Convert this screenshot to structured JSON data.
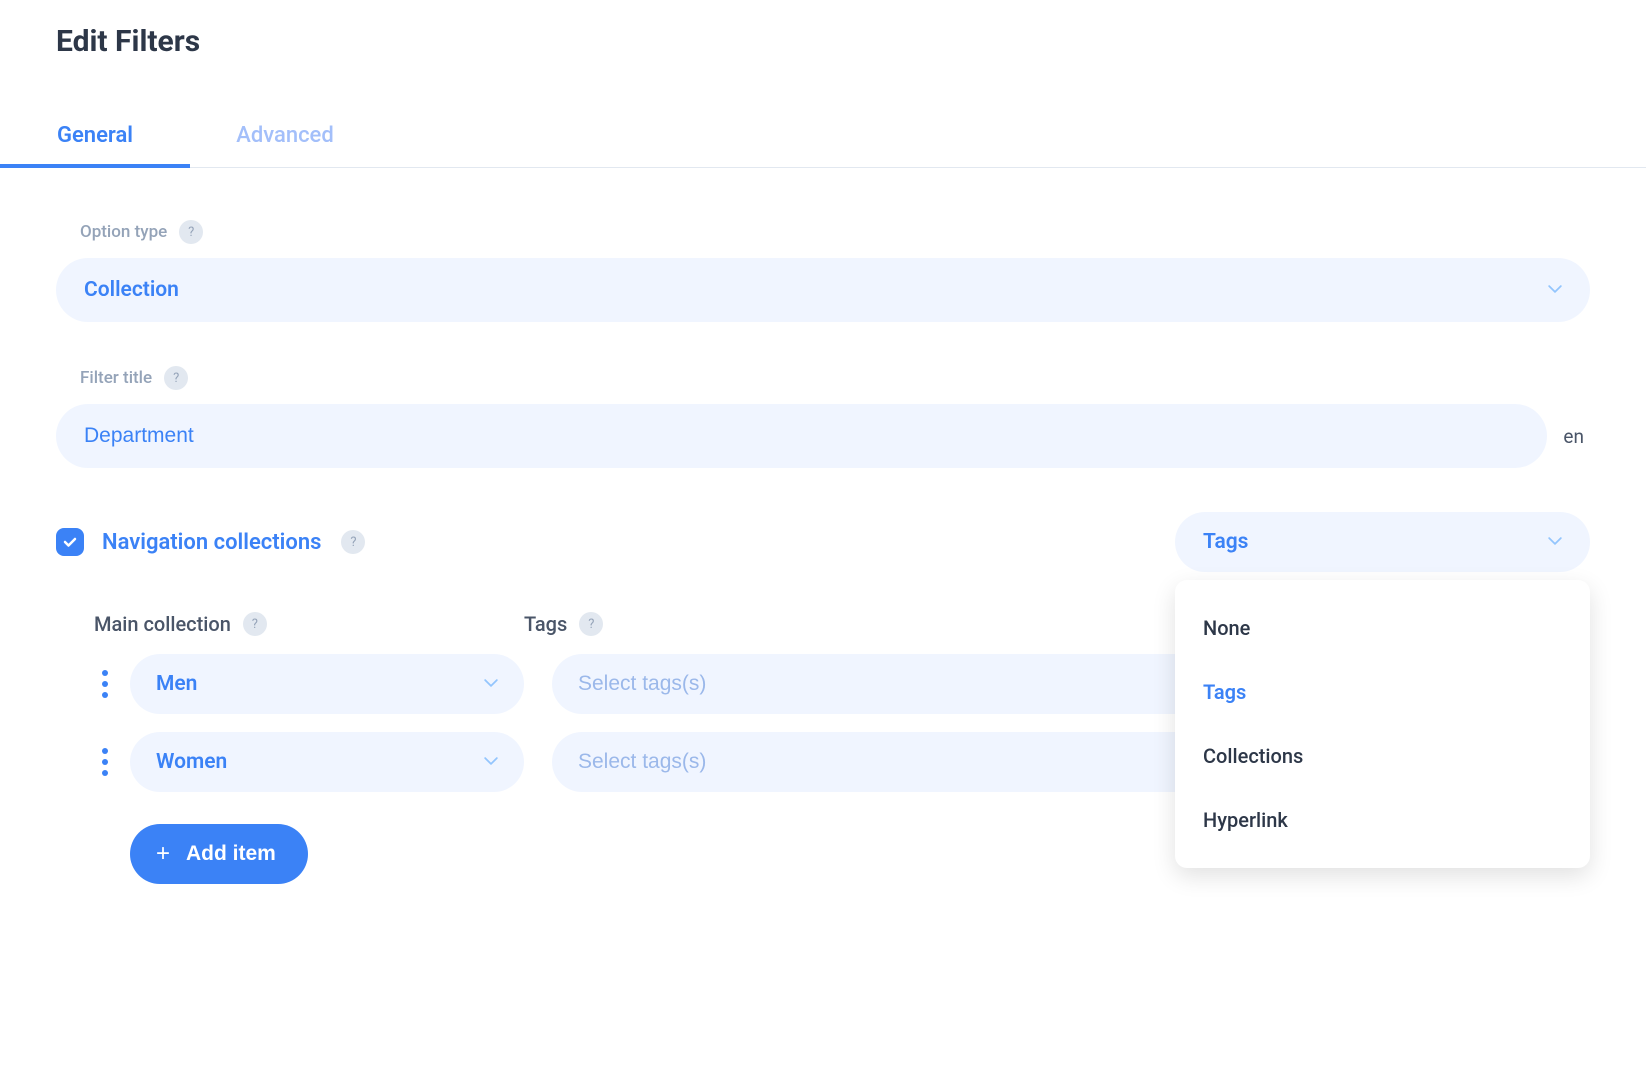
{
  "page": {
    "title": "Edit Filters"
  },
  "tabs": [
    {
      "label": "General",
      "active": true
    },
    {
      "label": "Advanced",
      "active": false
    }
  ],
  "fields": {
    "optionType": {
      "label": "Option type",
      "value": "Collection"
    },
    "filterTitle": {
      "label": "Filter title",
      "value": "Department",
      "langCode": "en"
    },
    "navCollections": {
      "label": "Navigation collections",
      "checked": true
    },
    "subCollectionType": {
      "value": "Tags",
      "options": [
        {
          "label": "None",
          "selected": false
        },
        {
          "label": "Tags",
          "selected": true
        },
        {
          "label": "Collections",
          "selected": false
        },
        {
          "label": "Hyperlink",
          "selected": false
        }
      ]
    }
  },
  "collectionsTable": {
    "headers": {
      "main": "Main collection",
      "tags": "Tags"
    },
    "rows": [
      {
        "main": "Men",
        "tagsPlaceholder": "Select tags(s)"
      },
      {
        "main": "Women",
        "tagsPlaceholder": "Select tags(s)"
      }
    ]
  },
  "buttons": {
    "addItem": "Add item"
  }
}
